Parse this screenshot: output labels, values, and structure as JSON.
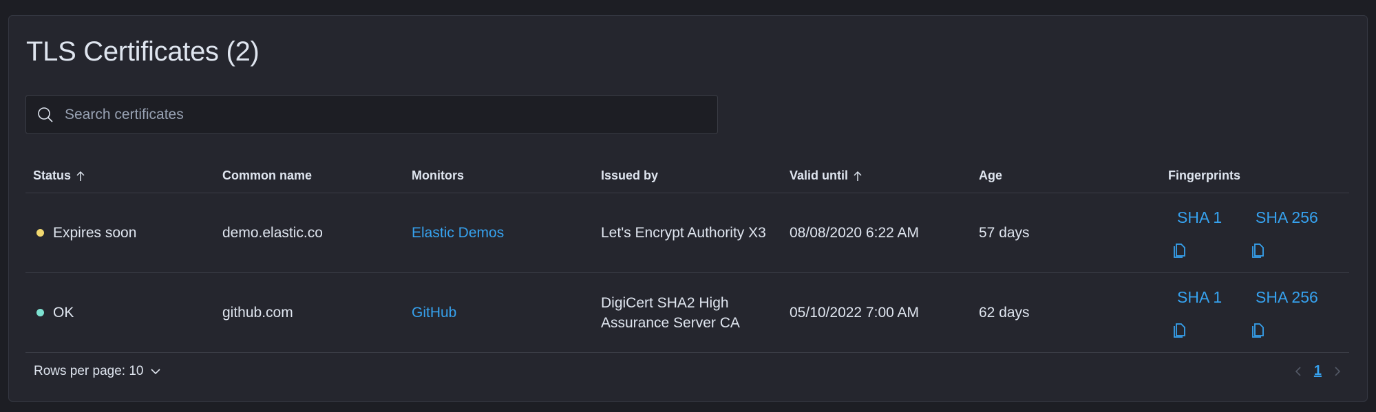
{
  "title": "TLS Certificates (2)",
  "search": {
    "placeholder": "Search certificates",
    "value": ""
  },
  "columns": {
    "status": "Status",
    "common_name": "Common name",
    "monitors": "Monitors",
    "issued_by": "Issued by",
    "valid_until": "Valid until",
    "age": "Age",
    "fingerprints": "Fingerprints"
  },
  "rows": [
    {
      "status": "Expires soon",
      "status_color": "#f1d86f",
      "common_name": "demo.elastic.co",
      "monitor": "Elastic Demos",
      "issued_by": "Let's Encrypt Authority X3",
      "valid_until": "08/08/2020 6:22 AM",
      "age": "57 days",
      "sha1": "SHA 1",
      "sha256": "SHA 256"
    },
    {
      "status": "OK",
      "status_color": "#7de2d1",
      "common_name": "github.com",
      "monitor": "GitHub",
      "issued_by": "DigiCert SHA2 High Assurance Server CA",
      "valid_until": "05/10/2022 7:00 AM",
      "age": "62 days",
      "sha1": "SHA 1",
      "sha256": "SHA 256"
    }
  ],
  "footer": {
    "rows_per_page": "Rows per page: 10"
  },
  "pagination": {
    "current_page": "1"
  },
  "colors": {
    "accent": "#36a2ef",
    "background": "#1d1e24",
    "panel": "#25262e"
  }
}
